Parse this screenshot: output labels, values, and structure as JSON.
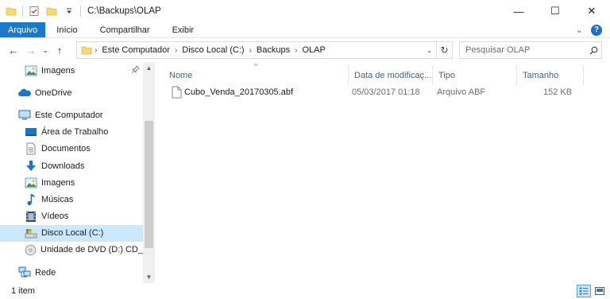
{
  "window": {
    "title": "C:\\Backups\\OLAP",
    "minimize_glyph": "—",
    "maximize_glyph": "☐",
    "close_glyph": "✕"
  },
  "ribbon": {
    "tabs": [
      "Arquivo",
      "Início",
      "Compartilhar",
      "Exibir"
    ],
    "expand_glyph": "⌄",
    "help_glyph": "?"
  },
  "address": {
    "back_glyph": "←",
    "forward_glyph": "→",
    "history_glyph": "⌄",
    "up_glyph": "↑",
    "crumbs": [
      "Este Computador",
      "Disco Local (C:)",
      "Backups",
      "OLAP"
    ],
    "crumb_sep": "›",
    "dropdown_glyph": "⌄",
    "refresh_glyph": "↻"
  },
  "search": {
    "placeholder": "Pesquisar OLAP"
  },
  "navpane": {
    "items": [
      {
        "label": "Imagens",
        "icon": "pictures-icon",
        "pinned": true
      },
      {
        "label": "OneDrive",
        "icon": "onedrive-icon"
      },
      {
        "label": "Este Computador",
        "icon": "computer-icon"
      },
      {
        "label": "Área de Trabalho",
        "icon": "desktop-icon"
      },
      {
        "label": "Documentos",
        "icon": "documents-icon"
      },
      {
        "label": "Downloads",
        "icon": "downloads-icon"
      },
      {
        "label": "Imagens",
        "icon": "pictures-icon"
      },
      {
        "label": "Músicas",
        "icon": "music-icon"
      },
      {
        "label": "Vídeos",
        "icon": "videos-icon"
      },
      {
        "label": "Disco Local (C:)",
        "icon": "drive-icon",
        "selected": true
      },
      {
        "label": "Unidade de DVD (D:) CD_RO",
        "icon": "dvd-icon"
      },
      {
        "label": "Rede",
        "icon": "network-icon"
      }
    ]
  },
  "columns": {
    "name": "Nome",
    "date": "Data de modificaç...",
    "type": "Tipo",
    "size": "Tamanho",
    "sort_glyph": "^"
  },
  "files": [
    {
      "name": "Cubo_Venda_20170305.abf",
      "date": "05/03/2017 01:18",
      "type": "Arquivo ABF",
      "size": "152 KB",
      "icon": "file-icon"
    }
  ],
  "status": {
    "count": "1 item"
  },
  "colors": {
    "accent": "#1979ca",
    "selection": "#cce8ff",
    "folder": "#f8d775",
    "header_text": "#4c607a"
  }
}
